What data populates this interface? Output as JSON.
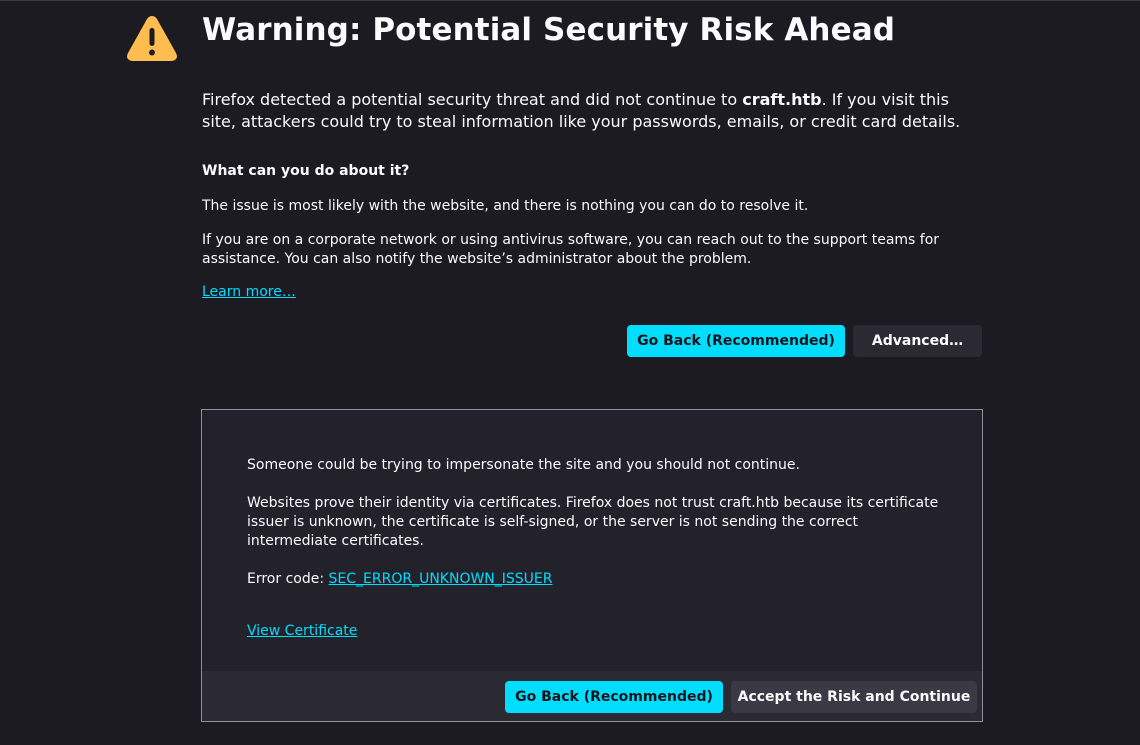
{
  "page": {
    "title": "Warning: Potential Security Risk Ahead",
    "intro_prefix": "Firefox detected a potential security threat and did not continue to ",
    "intro_host": "craft.htb",
    "intro_suffix": ". If you visit this site, attackers could try to steal information like your passwords, emails, or credit card details.",
    "what_heading": "What can you do about it?",
    "what_p1": "The issue is most likely with the website, and there is nothing you can do to resolve it.",
    "what_p2": "If you are on a corporate network or using antivirus software, you can reach out to the support teams for assistance. You can also notify the website’s administrator about the problem.",
    "learn_more": "Learn more…",
    "go_back_label": "Go Back (Recommended)",
    "advanced_label": "Advanced…"
  },
  "advanced": {
    "p1": "Someone could be trying to impersonate the site and you should not continue.",
    "p2": "Websites prove their identity via certificates. Firefox does not trust craft.htb because its certificate issuer is unknown, the certificate is self-signed, or the server is not sending the correct intermediate certificates.",
    "error_prefix": "Error code: ",
    "error_code": "SEC_ERROR_UNKNOWN_ISSUER",
    "view_certificate": "View Certificate",
    "go_back_label": "Go Back (Recommended)",
    "accept_label": "Accept the Risk and Continue"
  },
  "icons": {
    "warning": "warning-icon"
  },
  "colors": {
    "background": "#1c1b22",
    "panel": "#23222b",
    "accent": "#00ddff",
    "warning": "#ffbd4f",
    "text": "#fbfbfe"
  }
}
